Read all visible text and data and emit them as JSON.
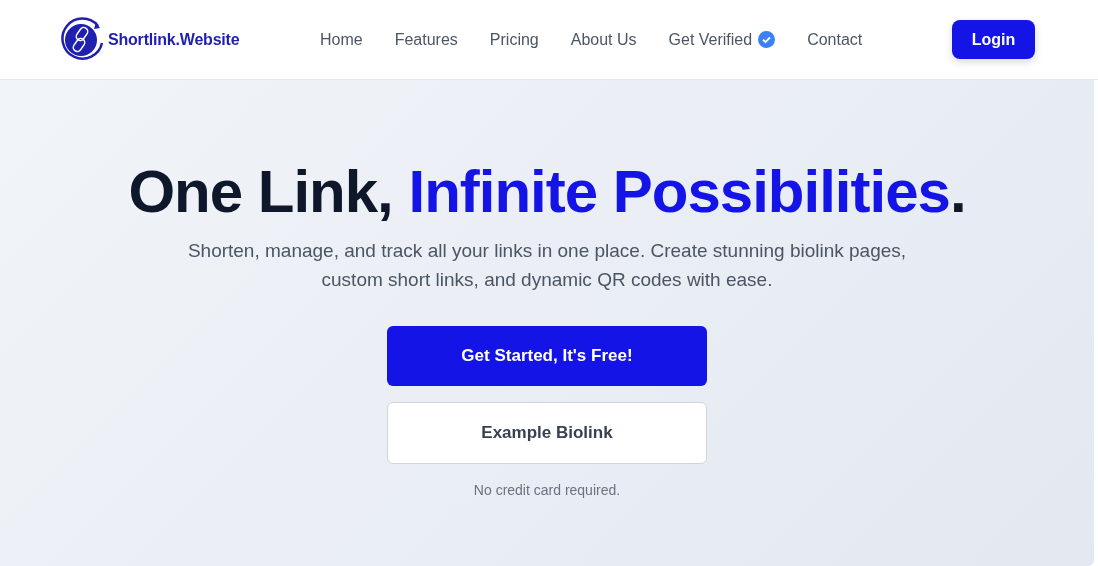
{
  "brand": {
    "name": "Shortlink.Website"
  },
  "nav": [
    {
      "label": "Home",
      "verified": false
    },
    {
      "label": "Features",
      "verified": false
    },
    {
      "label": "Pricing",
      "verified": false
    },
    {
      "label": "About Us",
      "verified": false
    },
    {
      "label": "Get Verified",
      "verified": true
    },
    {
      "label": "Contact",
      "verified": false
    }
  ],
  "login": "Login",
  "hero": {
    "headline_lead": "One Link,",
    "headline_highlight": "Infinite Possibilities",
    "headline_tail": ".",
    "subtitle": "Shorten, manage, and track all your links in one place. Create stunning biolink pages, custom short links, and dynamic QR codes with ease.",
    "primary_button": "Get Started, It's Free!",
    "secondary_button": "Example Biolink",
    "note": "No credit card required."
  }
}
